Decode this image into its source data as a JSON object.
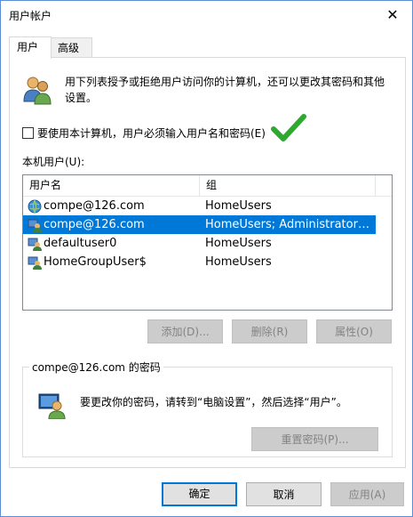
{
  "window": {
    "title": "用户帐户"
  },
  "tabs": [
    {
      "label": "用户",
      "active": true
    },
    {
      "label": "高级",
      "active": false
    }
  ],
  "description": "用下列表授予或拒绝用户访问你的计算机，还可以更改其密码和其他设置。",
  "require_login": {
    "label": "要使用本计算机，用户必须输入用户名和密码(E)",
    "checked": false
  },
  "local_users_label": "本机用户(U):",
  "users_table": {
    "columns": [
      "用户名",
      "组"
    ],
    "rows": [
      {
        "name": "compe@126.com",
        "group": "HomeUsers",
        "icon": "user-globe-icon",
        "selected": false
      },
      {
        "name": "compe@126.com",
        "group": "HomeUsers; Administrators; U...",
        "icon": "user-admin-icon",
        "selected": true
      },
      {
        "name": "defaultuser0",
        "group": "HomeUsers",
        "icon": "user-admin-icon",
        "selected": false
      },
      {
        "name": "HomeGroupUser$",
        "group": "HomeUsers",
        "icon": "user-admin-icon",
        "selected": false
      }
    ]
  },
  "actions": {
    "add": "添加(D)...",
    "remove": "删除(R)",
    "properties": "属性(O)"
  },
  "password_group": {
    "title": "compe@126.com 的密码",
    "text": "要更改你的密码，请转到“电脑设置”，然后选择“用户”。",
    "reset_button": "重置密码(P)..."
  },
  "footer": {
    "ok": "确定",
    "cancel": "取消",
    "apply": "应用(A)"
  },
  "colors": {
    "selection": "#0078d7",
    "accent_check": "#2ea82e",
    "window_border": "#5a8fd6"
  }
}
